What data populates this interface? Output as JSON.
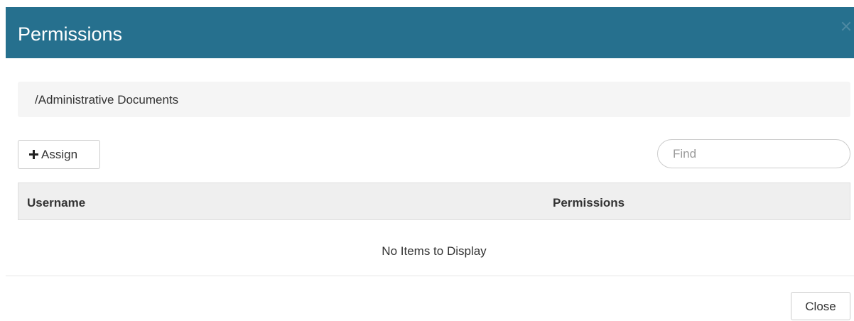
{
  "dialog": {
    "title": "Permissions",
    "close_icon": "close-icon",
    "accent_color": "#26708e"
  },
  "breadcrumb": {
    "path": "/Administrative Documents"
  },
  "toolbar": {
    "assign_label": "Assign",
    "assign_icon": "plus-icon",
    "search_placeholder": "Find"
  },
  "table": {
    "columns": [
      "Username",
      "Permissions"
    ],
    "rows": [],
    "empty_message": "No Items to Display"
  },
  "footer": {
    "close_label": "Close"
  }
}
